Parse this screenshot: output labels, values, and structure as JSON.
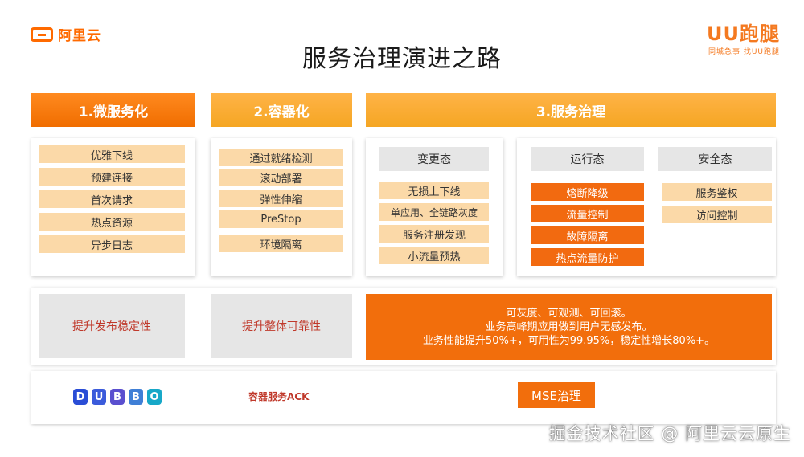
{
  "brand": {
    "left_logo": "阿里云",
    "right_logo": "UU跑腿",
    "right_slogan": "同城急事 找UU跑腿"
  },
  "title": "服务治理演进之路",
  "columns": {
    "col1": {
      "header": "1.微服务化",
      "items": [
        "优雅下线",
        "预建连接",
        "首次请求",
        "热点资源",
        "异步日志"
      ],
      "summary": "提升发布稳定性"
    },
    "col2": {
      "header": "2.容器化",
      "items": [
        "通过就绪检测",
        "滚动部署",
        "弹性伸缩",
        "PreStop",
        "环境隔离"
      ],
      "summary": "提升整体可靠性"
    },
    "col3": {
      "header": "3.服务治理",
      "change": {
        "title": "变更态",
        "items": [
          "无损上下线",
          "单应用、全链路灰度",
          "服务注册发现",
          "小流量预热"
        ]
      },
      "runtime": {
        "title": "运行态",
        "items": [
          "熔断降级",
          "流量控制",
          "故障隔离",
          "热点流量防护"
        ]
      },
      "security": {
        "title": "安全态",
        "items": [
          "服务鉴权",
          "访问控制"
        ]
      },
      "summary": [
        "可灰度、可观测、可回滚。",
        "业务高峰期应用做到用户无感发布。",
        "业务性能提升50%+，可用性为99.95%，稳定性增长80%+。"
      ]
    }
  },
  "bottom": {
    "dubbo_letters": [
      "D",
      "U",
      "B",
      "B",
      "O"
    ],
    "ack": "容器服务ACK",
    "mse": "MSE治理"
  },
  "watermark": "掘金技术社区 @ 阿里云云原生",
  "colors": {
    "orange": "#f26e0c",
    "light_orange": "#fbd9a8",
    "grey": "#e6e6e6"
  }
}
